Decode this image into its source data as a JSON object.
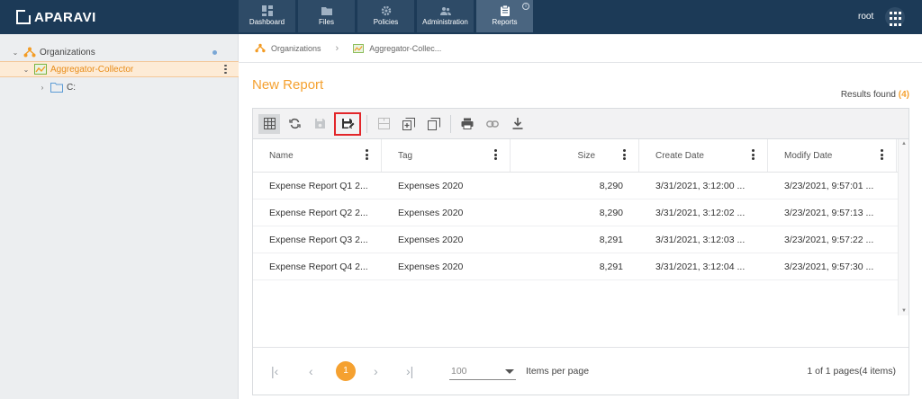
{
  "app": {
    "brand": "APARAVI",
    "user": "root"
  },
  "nav": [
    {
      "label": "Dashboard",
      "icon": "dashboard-icon"
    },
    {
      "label": "Files",
      "icon": "folder-icon"
    },
    {
      "label": "Policies",
      "icon": "gear-icon"
    },
    {
      "label": "Administration",
      "icon": "users-icon"
    },
    {
      "label": "Reports",
      "icon": "clipboard-icon",
      "active": true
    }
  ],
  "sidebar": {
    "items": [
      {
        "label": "Organizations"
      },
      {
        "label": "Aggregator-Collector",
        "selected": true
      },
      {
        "label": "C:"
      }
    ]
  },
  "breadcrumb": [
    "Organizations",
    "Aggregator-Collec..."
  ],
  "report": {
    "title": "New Report",
    "results_label": "Results found",
    "results_count": "(4)"
  },
  "table": {
    "columns": [
      "Name",
      "Tag",
      "Size",
      "Create Date",
      "Modify Date"
    ],
    "rows": [
      [
        "Expense Report Q1 2...",
        "Expenses 2020",
        "8,290",
        "3/31/2021, 3:12:00 ...",
        "3/23/2021, 9:57:01 ..."
      ],
      [
        "Expense Report Q2 2...",
        "Expenses 2020",
        "8,290",
        "3/31/2021, 3:12:02 ...",
        "3/23/2021, 9:57:13 ..."
      ],
      [
        "Expense Report Q3 2...",
        "Expenses 2020",
        "8,291",
        "3/31/2021, 3:12:03 ...",
        "3/23/2021, 9:57:22 ..."
      ],
      [
        "Expense Report Q4 2...",
        "Expenses 2020",
        "8,291",
        "3/31/2021, 3:12:04 ...",
        "3/23/2021, 9:57:30 ..."
      ]
    ]
  },
  "pager": {
    "current_page": "1",
    "items_per_page": "100",
    "items_per_page_label": "Items per page",
    "info": "1 of 1 pages(4 items)"
  },
  "colors": {
    "topbar": "#1c3a57",
    "accent": "#f5a130",
    "highlight_box": "#e2262a"
  }
}
